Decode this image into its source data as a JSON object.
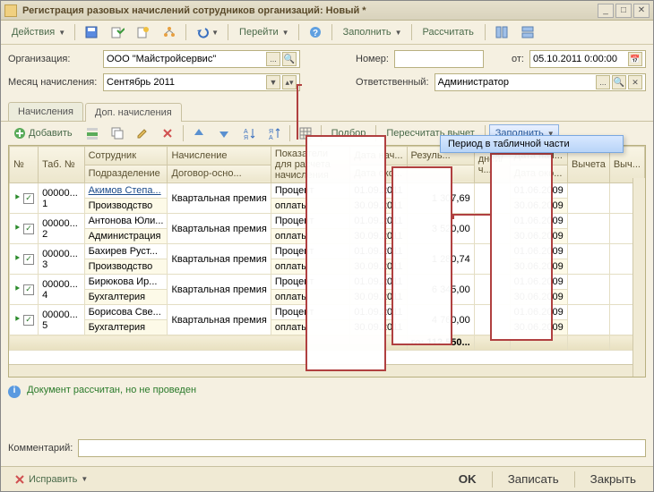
{
  "window": {
    "title": "Регистрация разовых начислений сотрудников организаций: Новый *"
  },
  "main_toolbar": {
    "actions": "Действия",
    "goto": "Перейти",
    "fill": "Заполнить",
    "recalc": "Рассчитать"
  },
  "header": {
    "org_label": "Организация:",
    "org_value": "ООО \"Майстройсервис\"",
    "number_label": "Номер:",
    "date_label": "от:",
    "date_value": "05.10.2011 0:00:00",
    "month_label": "Месяц начисления:",
    "month_value": "Сентябрь 2011",
    "resp_label": "Ответственный:",
    "resp_value": "Администратор"
  },
  "tabs": {
    "t1": "Начисления",
    "t2": "Доп. начисления"
  },
  "grid_toolbar": {
    "add": "Добавить",
    "select": "Подбор",
    "recalc_ded": "Пересчитать вычет",
    "fill": "Заполнить"
  },
  "popup": {
    "item1": "Период в табличной части"
  },
  "columns": {
    "n": "№",
    "tab": "Таб. №",
    "emp": "Сотрудник",
    "subd": "Подразделение",
    "accr": "Начисление",
    "contr": "Договор-осно...",
    "indic": "Показатели для расчета начисления",
    "res": "Резуль...",
    "days": "дней/ч...",
    "d_start": "Дата нач...",
    "d_end": "Дата око...",
    "ded": "Вычета",
    "ded2": "Выч..."
  },
  "rows": [
    {
      "n": "1",
      "tab": "00000...",
      "emp": "Акимов Степа...",
      "dept": "Производство",
      "accr": "Квартальная премия",
      "ind1": "Процент",
      "ind2": "оплаты",
      "d1": "01.09.2011",
      "d2": "30.09.2011",
      "res": "1 307,69",
      "de1": "01.06.2009",
      "de2": "30.06.2009"
    },
    {
      "n": "2",
      "tab": "00000...",
      "emp": "Антонова Юли...",
      "dept": "Администрация",
      "accr": "Квартальная премия",
      "ind1": "Процент",
      "ind2": "оплаты",
      "d1": "01.09.2011",
      "d2": "30.09.2011",
      "res": "3 520,00",
      "de1": "01.06.2009",
      "de2": "30.06.2009"
    },
    {
      "n": "3",
      "tab": "00000...",
      "emp": "Бахирев Руст...",
      "dept": "Производство",
      "accr": "Квартальная премия",
      "ind1": "Процент",
      "ind2": "оплаты",
      "d1": "01.09.2011",
      "d2": "30.09.2011",
      "res": "1 280,74",
      "de1": "01.06.2009",
      "de2": "30.06.2009"
    },
    {
      "n": "4",
      "tab": "00000...",
      "emp": "Бирюкова Ир...",
      "dept": "Бухгалтерия",
      "accr": "Квартальная премия",
      "ind1": "Процент",
      "ind2": "оплаты",
      "d1": "01.09.2011",
      "d2": "30.09.2011",
      "res": "6 345,00",
      "de1": "01.06.2009",
      "de2": "30.06.2009"
    },
    {
      "n": "5",
      "tab": "00000...",
      "emp": "Борисова Све...",
      "dept": "Бухгалтерия",
      "accr": "Квартальная премия",
      "ind1": "Процент",
      "ind2": "оплаты",
      "d1": "01.09.2011",
      "d2": "30.09.2011",
      "res": "4 760,00",
      "de1": "01.06.2009",
      "de2": "30.06.2009"
    }
  ],
  "total": {
    "label": "го:",
    "value": "112 550..."
  },
  "status": {
    "text": "Документ рассчитан, но не проведен"
  },
  "comment": {
    "label": "Комментарий:"
  },
  "bottom": {
    "fix": "Исправить",
    "ok": "OK",
    "save": "Записать",
    "close": "Закрыть"
  }
}
